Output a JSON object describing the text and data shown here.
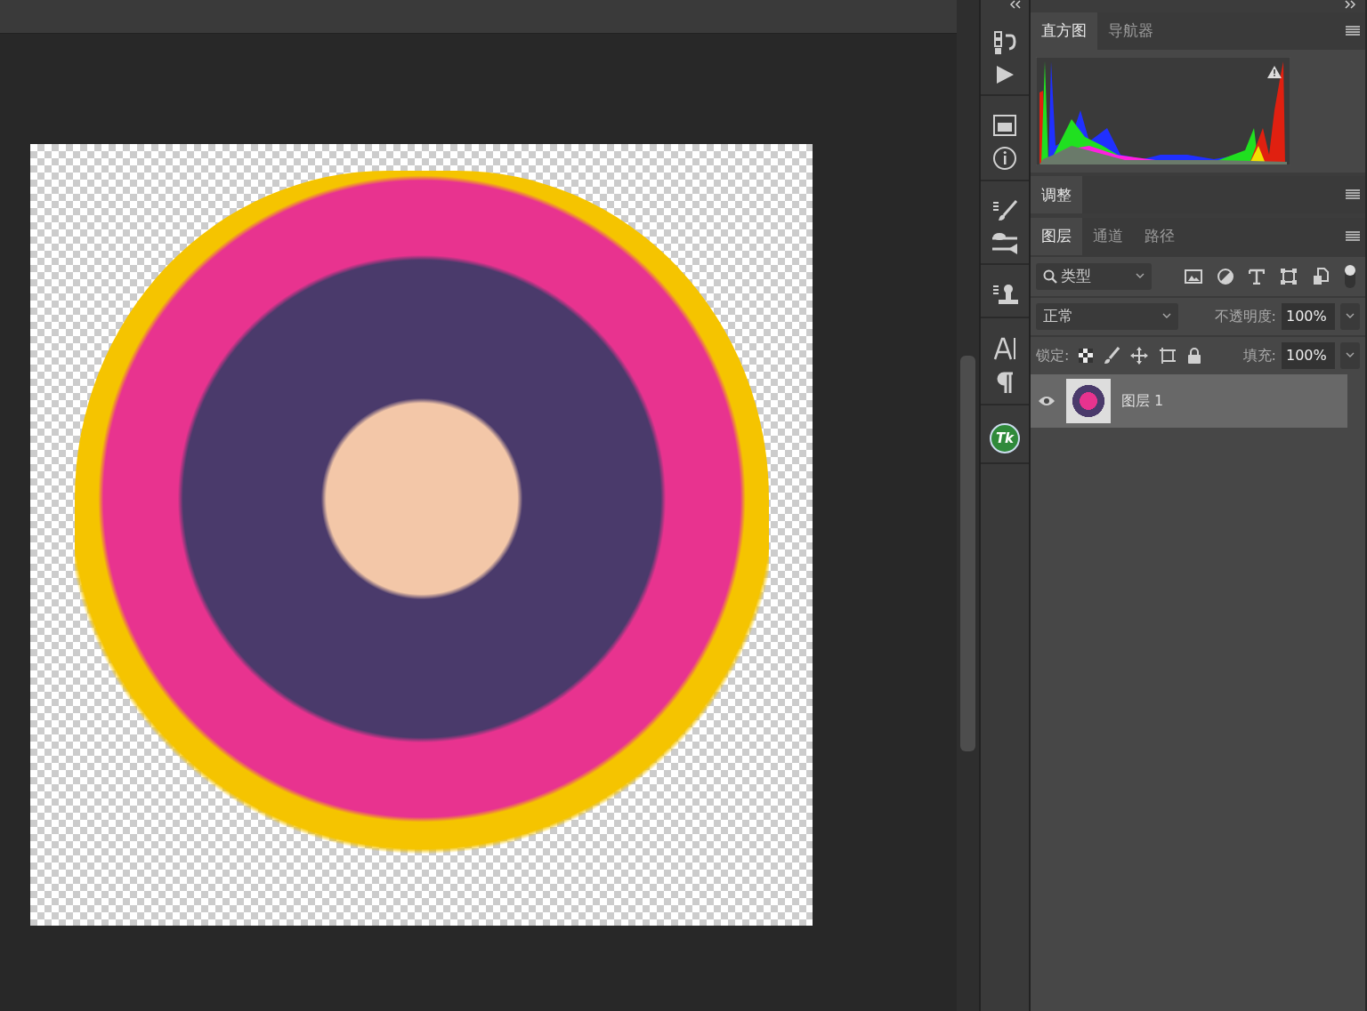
{
  "histogram_panel": {
    "tabs": [
      {
        "label": "直方图",
        "selected": true
      },
      {
        "label": "导航器",
        "selected": false
      }
    ]
  },
  "adjustments_panel": {
    "tabs": [
      {
        "label": "调整",
        "selected": true
      }
    ]
  },
  "layers_panel": {
    "tabs": [
      {
        "label": "图层",
        "selected": true
      },
      {
        "label": "通道",
        "selected": false
      },
      {
        "label": "路径",
        "selected": false
      }
    ],
    "filter": {
      "value": "类型"
    },
    "blend_mode": {
      "value": "正常"
    },
    "opacity": {
      "label": "不透明度:",
      "value": "100%"
    },
    "lock": {
      "label": "锁定:"
    },
    "fill": {
      "label": "填充:",
      "value": "100%"
    },
    "layers": [
      {
        "name": "图层 1",
        "visible": true,
        "selected": true
      }
    ]
  },
  "toolstrip": {
    "plugin_logo": "Tk"
  }
}
